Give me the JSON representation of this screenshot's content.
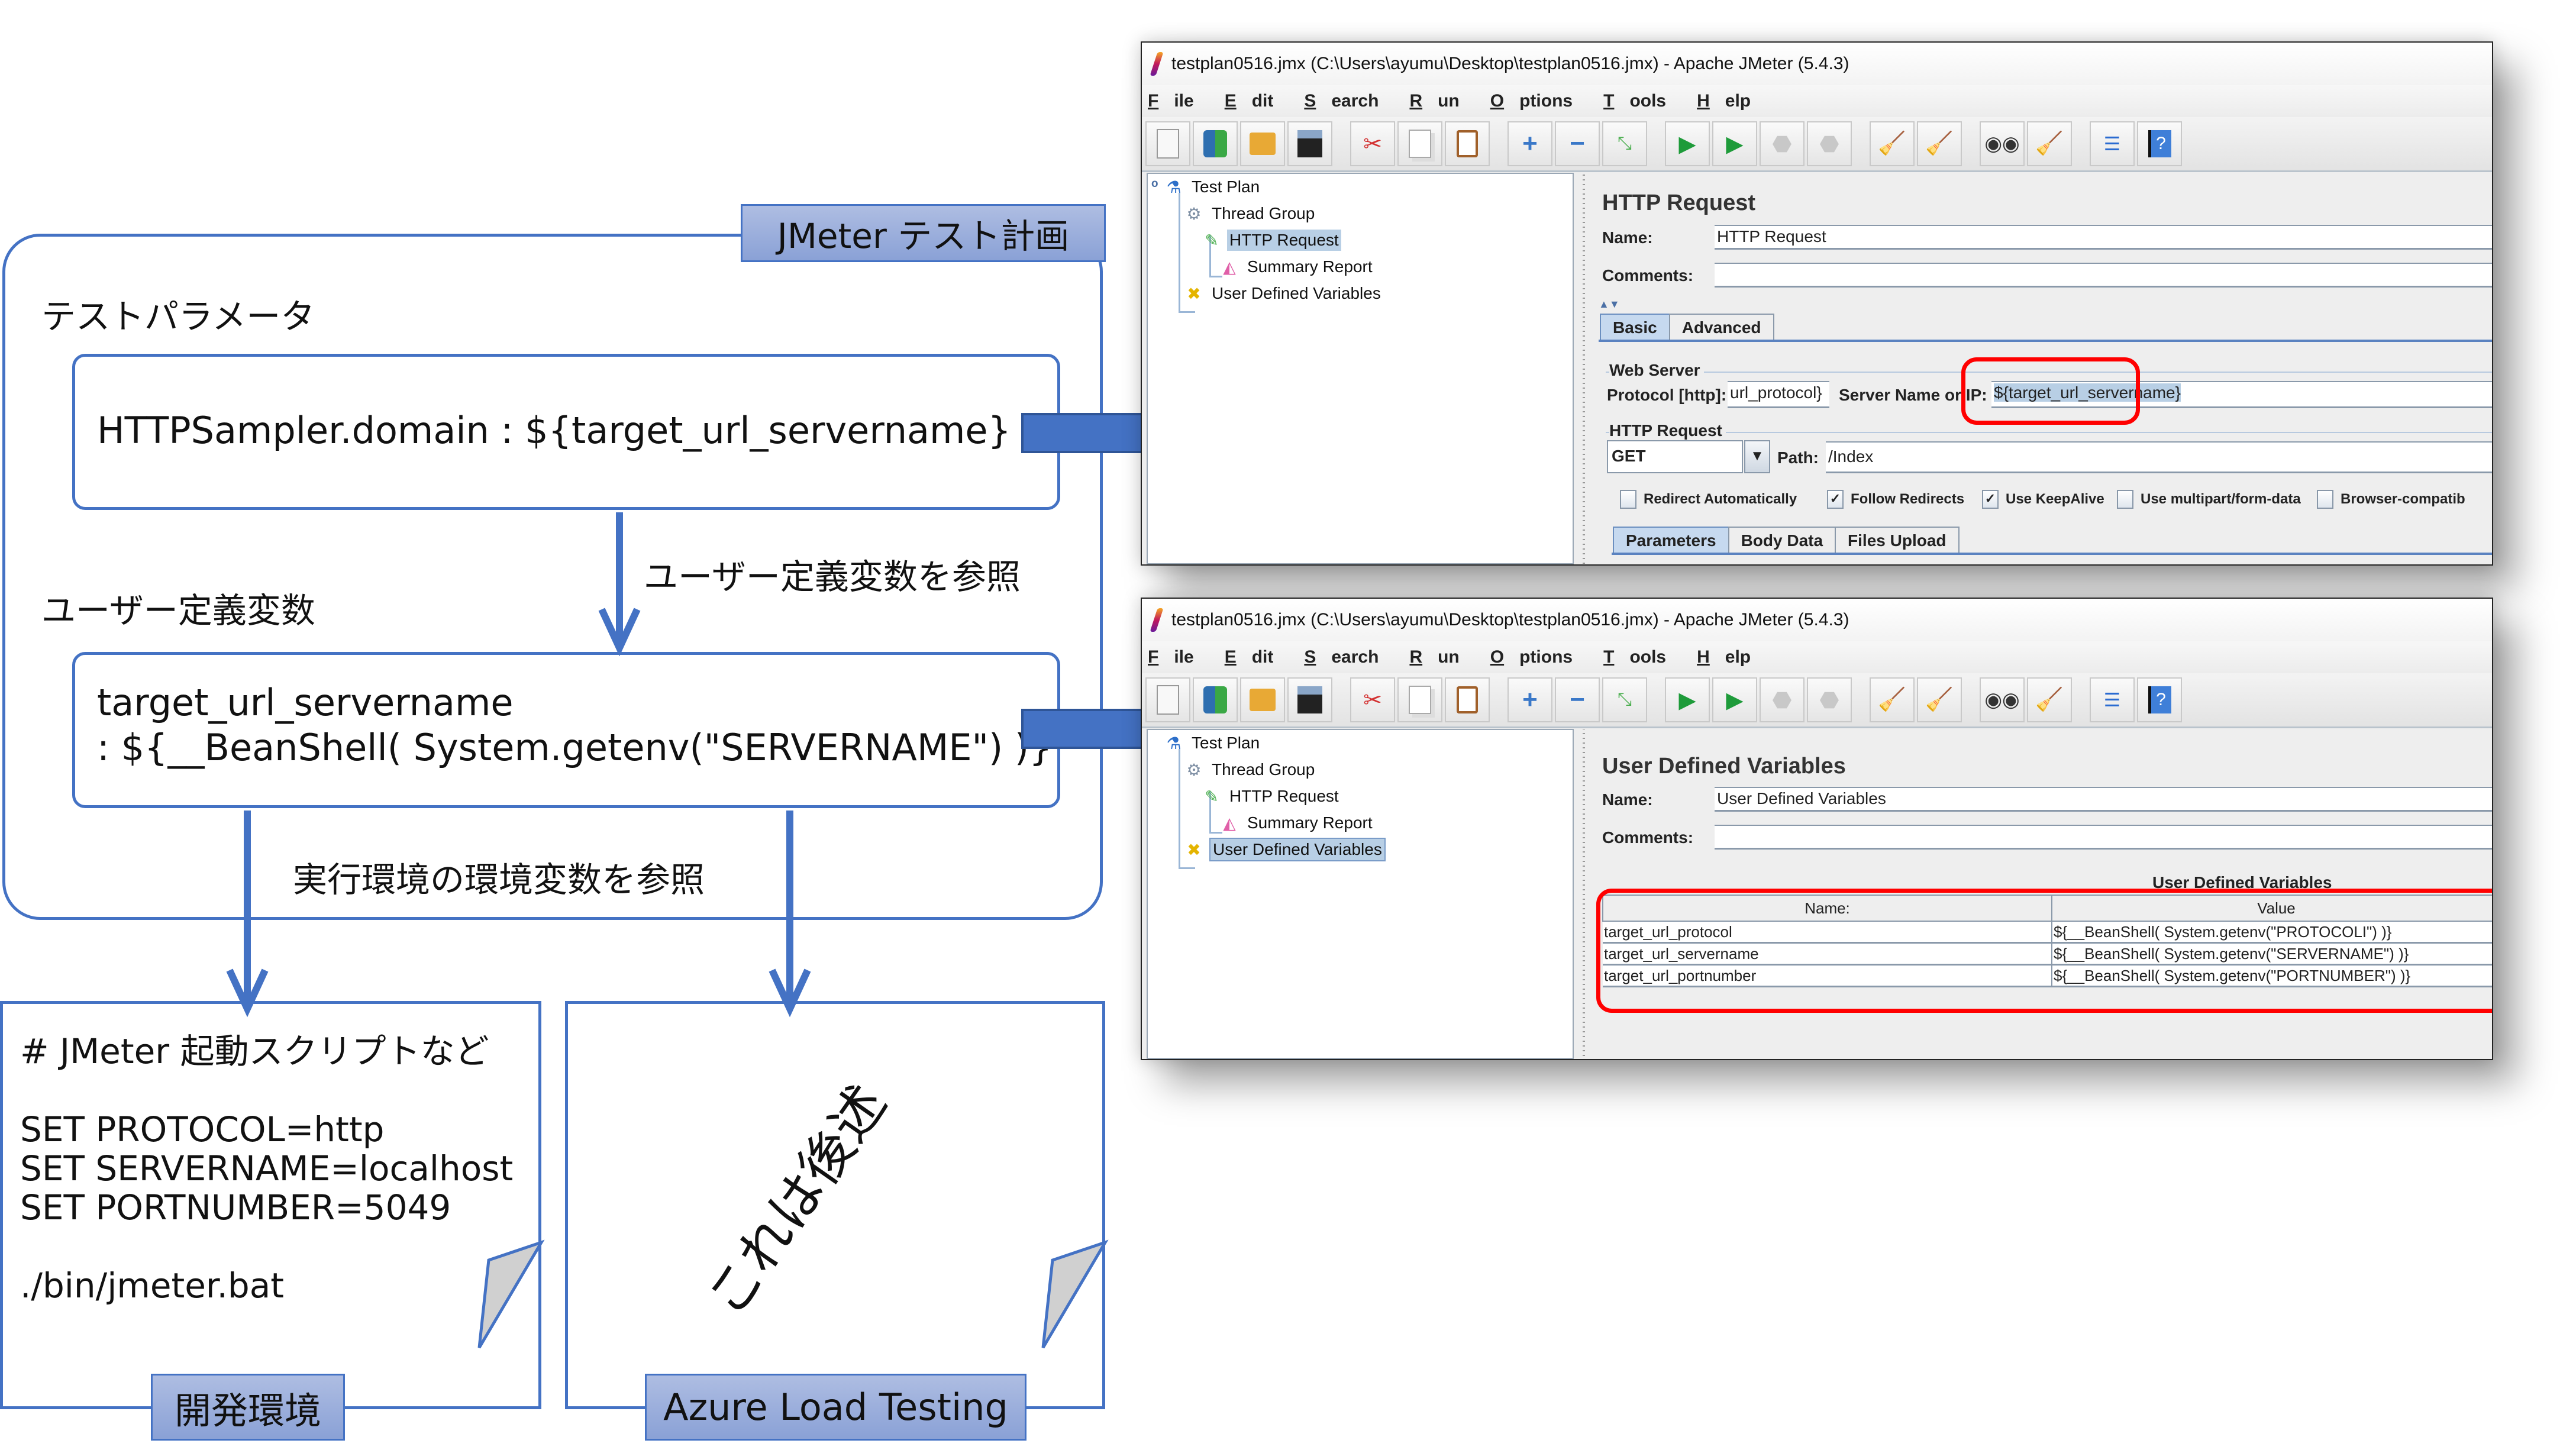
{
  "diagram": {
    "plan_label": "JMeter テスト計画",
    "test_params_label": "テストパラメータ",
    "box1_text": "HTTPSampler.domain : ${target_url_servername}",
    "ref_udv_label": "ユーザー定義変数を参照",
    "udv_label": "ユーザー定義変数",
    "box2_line1": "target_url_servername",
    "box2_line2": ": ${__BeanShell( System.getenv(\"SERVERNAME\") )}",
    "ref_env_label": "実行環境の環境変数を参照",
    "doc1": {
      "comment": "# JMeter 起動スクリプトなど",
      "lines": [
        "SET PROTOCOL=http",
        "SET SERVERNAME=localhost",
        "SET PORTNUMBER=5049"
      ],
      "command": "./bin/jmeter.bat",
      "tag": "開発環境"
    },
    "doc2": {
      "note": "これは後述",
      "tag": "Azure Load Testing"
    },
    "colors": {
      "accent": "#4472c4",
      "tag_fill": "#8ea5d9",
      "highlight_ring": "#ff0000"
    }
  },
  "jmeter": {
    "window_title": "testplan0516.jmx (C:\\Users\\ayumu\\Desktop\\testplan0516.jmx) - Apache JMeter (5.4.3)",
    "menu": [
      {
        "mnemonic": "F",
        "rest": "ile"
      },
      {
        "mnemonic": "E",
        "rest": "dit"
      },
      {
        "mnemonic": "S",
        "rest": "earch"
      },
      {
        "mnemonic": "R",
        "rest": "un"
      },
      {
        "mnemonic": "O",
        "rest": "ptions"
      },
      {
        "mnemonic": "T",
        "rest": "ools"
      },
      {
        "mnemonic": "H",
        "rest": "elp"
      }
    ],
    "toolbar_icons": [
      "new-icon",
      "templates-icon",
      "open-icon",
      "save-icon",
      "cut-icon",
      "copy-icon",
      "paste-icon",
      "expand-icon",
      "collapse-icon",
      "toggle-icon",
      "start-icon",
      "start-no-pause-icon",
      "stop-icon",
      "shutdown-icon",
      "clear-icon",
      "clear-all-icon",
      "search-icon",
      "reset-search-icon",
      "function-helper-icon",
      "help-icon"
    ],
    "tree": [
      "Test Plan",
      "Thread Group",
      "HTTP Request",
      "Summary Report",
      "User Defined Variables"
    ],
    "http_window": {
      "selected_tree_item": "HTTP Request",
      "panel_title": "HTTP Request",
      "name_label": "Name:",
      "name_value": "HTTP Request",
      "comments_label": "Comments:",
      "comments_value": "",
      "tabs": [
        "Basic",
        "Advanced"
      ],
      "active_tab": "Basic",
      "web_server_label": "Web Server",
      "protocol_label": "Protocol [http]:",
      "protocol_value": "url_protocol}",
      "server_label": "Server Name or IP:",
      "server_value": "${target_url_servername}",
      "http_request_label": "HTTP Request",
      "method": "GET",
      "path_label": "Path:",
      "path_value": "/Index",
      "checkboxes": [
        {
          "label": "Redirect Automatically",
          "checked": false
        },
        {
          "label": "Follow Redirects",
          "checked": true
        },
        {
          "label": "Use KeepAlive",
          "checked": true
        },
        {
          "label": "Use multipart/form-data",
          "checked": false
        },
        {
          "label": "Browser-compatib",
          "checked": false
        }
      ],
      "sub_tabs": [
        "Parameters",
        "Body Data",
        "Files Upload"
      ],
      "active_sub_tab": "Parameters"
    },
    "udv_window": {
      "selected_tree_item": "User Defined Variables",
      "panel_title": "User Defined Variables",
      "name_label": "Name:",
      "name_value": "User Defined Variables",
      "comments_label": "Comments:",
      "comments_value": "",
      "table_caption": "User Defined Variables",
      "columns": [
        "Name:",
        "Value"
      ],
      "rows": [
        [
          "target_url_protocol",
          "${__BeanShell( System.getenv(\"PROTOCOLI\") )}"
        ],
        [
          "target_url_servername",
          "${__BeanShell( System.getenv(\"SERVERNAME\") )}"
        ],
        [
          "target_url_portnumber",
          "${__BeanShell( System.getenv(\"PORTNUMBER\") )}"
        ]
      ]
    }
  }
}
